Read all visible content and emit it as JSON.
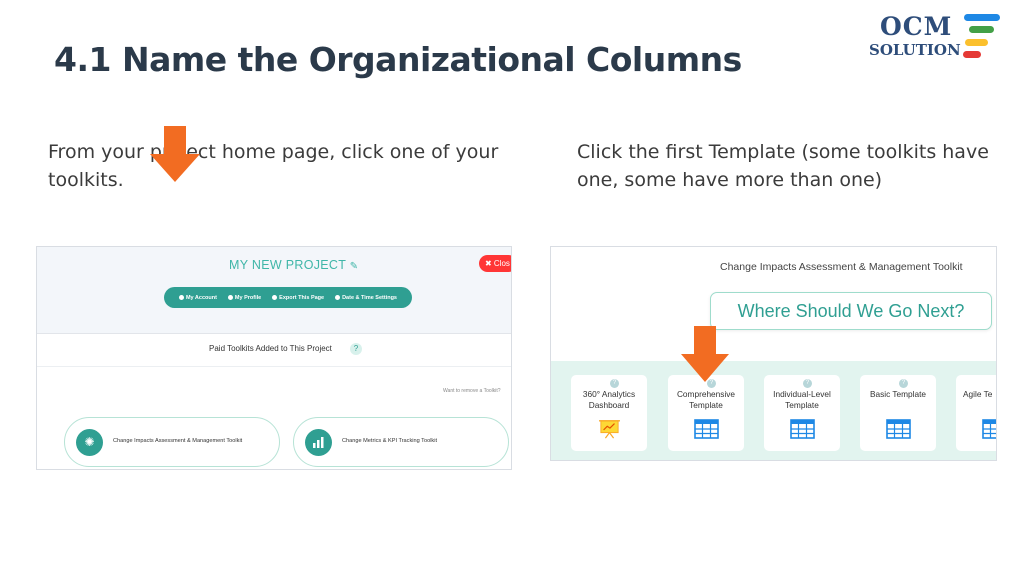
{
  "slide": {
    "title": "4.1 Name the Organizational Columns",
    "caption_left": "From your project home page, click one of your toolkits.",
    "caption_right": "Click the first Template (some toolkits have one, some have more than one)"
  },
  "logo": {
    "line1": "OCM",
    "line2": "SOLUTION",
    "bar_colors": [
      "#1e88e5",
      "#43a047",
      "#fbc02d",
      "#e53935"
    ]
  },
  "left_screenshot": {
    "project_title": "MY NEW PROJECT",
    "close_label": "✖ Clos",
    "nav_items": [
      "My Account",
      "My Profile",
      "Export This Page",
      "Date & Time Settings"
    ],
    "paid_toolkits_heading": "Paid Toolkits Added to This Project",
    "help_glyph": "?",
    "remove_hint": "Want to remove a Toolkit?",
    "toolkits": [
      {
        "label": "Change Impacts Assessment & Management Toolkit",
        "icon": "sparkle-icon"
      },
      {
        "label": "Change Metrics & KPI Tracking Toolkit",
        "icon": "bar-chart-icon"
      }
    ]
  },
  "right_screenshot": {
    "toolkit_title": "Change Impacts Assessment & Management Toolkit",
    "where_next": "Where Should We Go Next?",
    "templates": [
      {
        "line1": "360° Analytics",
        "line2": "Dashboard",
        "icon": "presentation-chart-icon"
      },
      {
        "line1": "Comprehensive",
        "line2": "Template",
        "icon": "table-grid-icon"
      },
      {
        "line1": "Individual-Level",
        "line2": "Template",
        "icon": "table-grid-icon"
      },
      {
        "line1": "Basic Template",
        "line2": "",
        "icon": "table-grid-icon"
      },
      {
        "line1": "Agile Te",
        "line2": "",
        "icon": "table-grid-icon"
      }
    ]
  },
  "colors": {
    "teal": "#2f9f92",
    "arrow_orange": "#f26c22",
    "title_dark": "#2b3a4a"
  }
}
